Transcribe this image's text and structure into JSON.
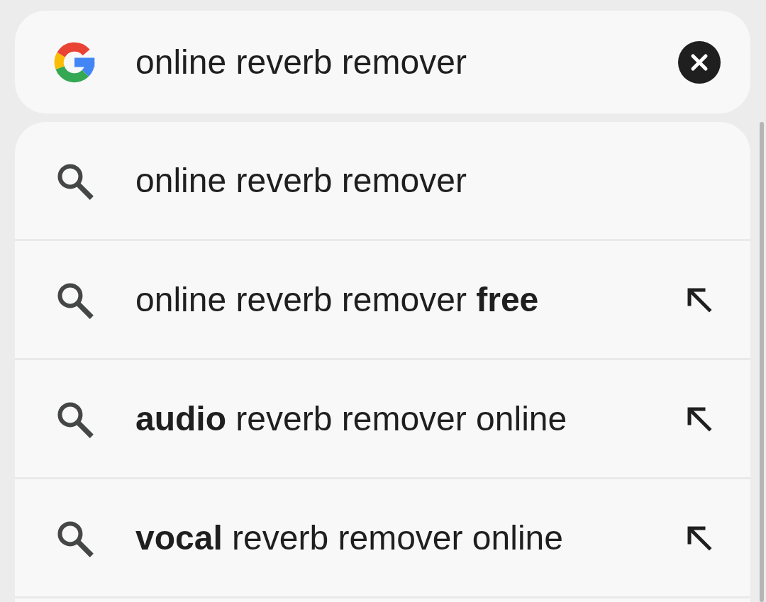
{
  "search": {
    "value": "online reverb remover"
  },
  "suggestions": [
    {
      "text": "online reverb remover",
      "kind": "typed"
    },
    {
      "text": "online reverb remover **free**",
      "kind": "completion"
    },
    {
      "text": "**audio** reverb remover online",
      "kind": "completion"
    },
    {
      "text": "**vocal** reverb remover online",
      "kind": "completion"
    }
  ]
}
